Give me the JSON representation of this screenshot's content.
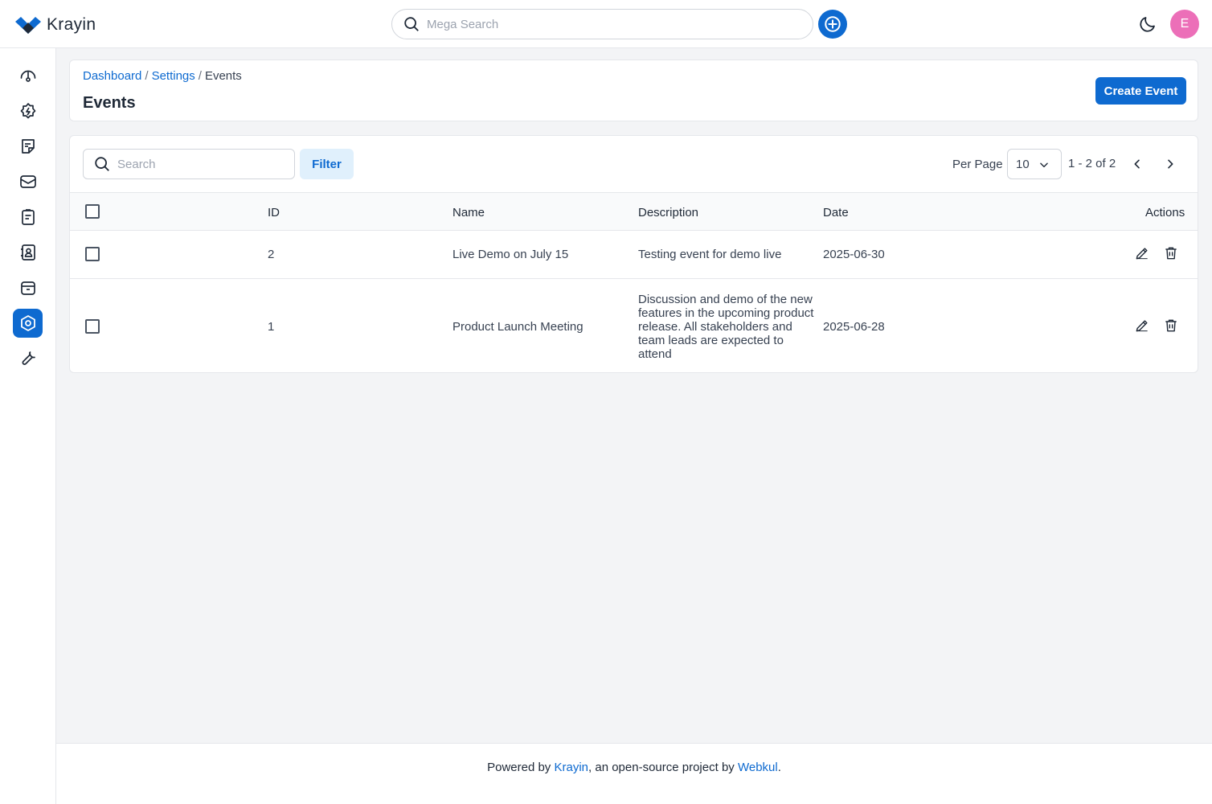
{
  "app": {
    "brand": "Krayin"
  },
  "header": {
    "search_placeholder": "Mega Search",
    "avatar_initial": "E",
    "colors": {
      "accent": "#0e6ad0",
      "avatar": "#ec6fb8"
    }
  },
  "sidebar": {
    "items": [
      {
        "icon": "dashboard-icon"
      },
      {
        "icon": "leads-icon"
      },
      {
        "icon": "quotes-icon"
      },
      {
        "icon": "mail-icon"
      },
      {
        "icon": "activities-icon"
      },
      {
        "icon": "contacts-icon"
      },
      {
        "icon": "products-icon"
      },
      {
        "icon": "settings-icon",
        "active": true
      },
      {
        "icon": "configuration-icon"
      }
    ]
  },
  "breadcrumb": {
    "item1": "Dashboard",
    "item2": "Settings",
    "item3": "Events",
    "sep": "/"
  },
  "page": {
    "title": "Events",
    "create_label": "Create Event"
  },
  "grid": {
    "search_placeholder": "Search",
    "filter_label": "Filter",
    "per_page_label": "Per Page",
    "per_page_value": "10",
    "pagination_info": "1 - 2 of 2",
    "columns": {
      "id": "ID",
      "name": "Name",
      "description": "Description",
      "date": "Date",
      "actions": "Actions"
    },
    "rows": [
      {
        "id": "2",
        "name": "Live Demo on July 15",
        "description": "Testing event for demo live",
        "date": "2025-06-30"
      },
      {
        "id": "1",
        "name": "Product Launch Meeting",
        "description": "Discussion and demo of the new features in the upcoming product release. All stakeholders and team leads are expected to attend",
        "date": "2025-06-28"
      }
    ]
  },
  "footer": {
    "prefix": "Powered by",
    "link1": "Krayin",
    "middle": ", an open-source project by",
    "link2": "Webkul",
    "suffix": "."
  }
}
